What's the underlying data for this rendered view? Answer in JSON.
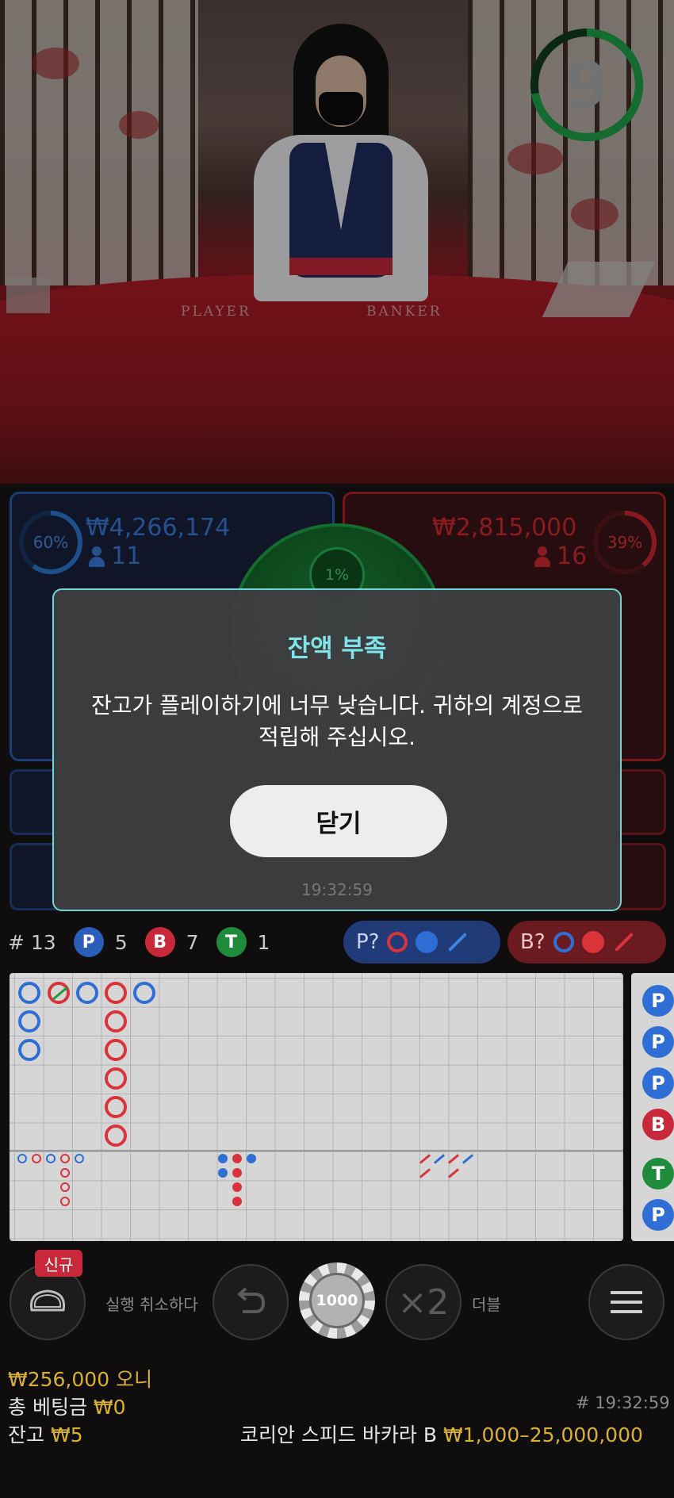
{
  "timer": {
    "value": "9",
    "color": "#1fa64a"
  },
  "table_felt": {
    "player_label": "PLAYER",
    "banker_label": "BANKER"
  },
  "player_pool": {
    "percent": "60%",
    "percent_value": 60,
    "amount": "₩4,266,174",
    "count": "11",
    "color": "#2a5eb8"
  },
  "banker_pool": {
    "percent": "39%",
    "percent_value": 39,
    "amount": "₩2,815,000",
    "count": "16",
    "color": "#b82226"
  },
  "tie_pool": {
    "percent": "1%",
    "percent_value": 1,
    "color": "#1fa64a"
  },
  "modal": {
    "title": "잔액 부족",
    "message": "잔고가 플레이하기에 너무 낮습니다. 귀하의 계정으로 적립해 주십시오.",
    "close_label": "닫기",
    "time": "19:32:59"
  },
  "stats": {
    "round": "# 13",
    "player_letter": "P",
    "player_count": "5",
    "banker_letter": "B",
    "banker_count": "7",
    "tie_letter": "T",
    "tie_count": "1"
  },
  "predictions": {
    "player_label": "P?",
    "banker_label": "B?"
  },
  "side_road": [
    "P",
    "P",
    "P",
    "B",
    "T",
    "P"
  ],
  "controls": {
    "new_badge": "신규",
    "undo_label": "실행 취소하다",
    "chip_value": "1000",
    "double_symbol": "×2",
    "double_label": "더블"
  },
  "footer": {
    "bet_line_amount": "₩256,000",
    "bet_line_suffix": "오니",
    "total_bet_label": "총 베팅금",
    "total_bet_value": "₩0",
    "balance_label": "잔고",
    "balance_value": "₩5",
    "timestamp": "# 19:32:59",
    "table_name": "코리안 스피드 바카라 B",
    "limits": "₩1,000–25,000,000"
  },
  "colors": {
    "player": "#2a5eb8",
    "banker": "#c8283a",
    "tie": "#1f8c3b",
    "accent": "#7fe3ea",
    "gold": "#d8b131"
  }
}
